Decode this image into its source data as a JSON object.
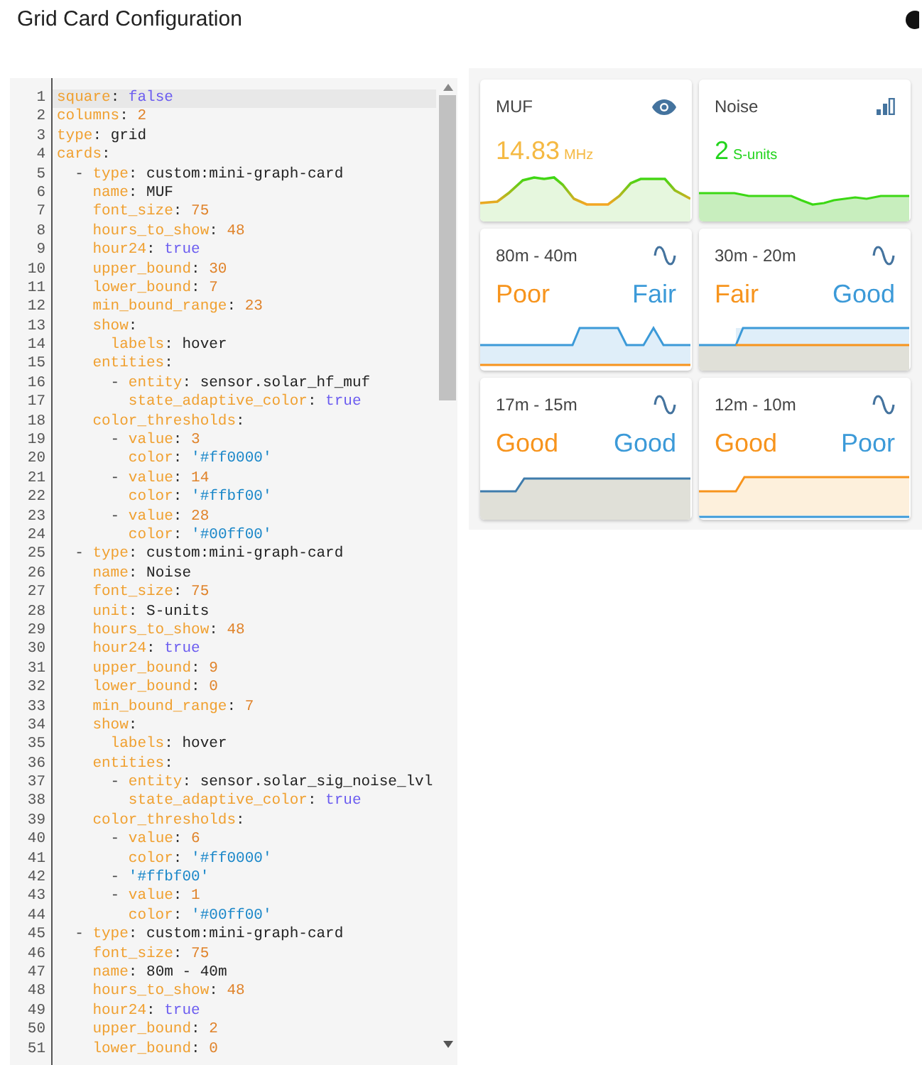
{
  "title": "Grid Card Configuration",
  "editor": {
    "lines": [
      {
        "n": "1",
        "active": true,
        "key": "square",
        "sep": ":",
        "value": " false",
        "kind": "bool"
      },
      {
        "n": "2",
        "active": false,
        "key": "columns",
        "sep": ":",
        "value": " 2",
        "kind": "num"
      },
      {
        "n": "3",
        "active": false,
        "key": "type",
        "sep": ":",
        "value": " grid",
        "kind": "plain"
      },
      {
        "n": "4",
        "active": false,
        "key": "cards",
        "sep": ":"
      },
      {
        "n": "5",
        "active": false,
        "lead": "  -",
        "key": " type",
        "sep": ":",
        "value": " custom:mini-graph-card",
        "kind": "plain"
      },
      {
        "n": "6",
        "active": false,
        "key": "    name",
        "sep": ":",
        "value": " MUF",
        "kind": "plain"
      },
      {
        "n": "7",
        "active": false,
        "key": "    font_size",
        "sep": ":",
        "value": " 75",
        "kind": "num"
      },
      {
        "n": "8",
        "active": false,
        "key": "    hours_to_show",
        "sep": ":",
        "value": " 48",
        "kind": "num"
      },
      {
        "n": "9",
        "active": false,
        "key": "    hour24",
        "sep": ":",
        "value": " true",
        "kind": "bool"
      },
      {
        "n": "10",
        "active": false,
        "key": "    upper_bound",
        "sep": ":",
        "value": " 30",
        "kind": "num"
      },
      {
        "n": "11",
        "active": false,
        "key": "    lower_bound",
        "sep": ":",
        "value": " 7",
        "kind": "num"
      },
      {
        "n": "12",
        "active": false,
        "key": "    min_bound_range",
        "sep": ":",
        "value": " 23",
        "kind": "num"
      },
      {
        "n": "13",
        "active": false,
        "key": "    show",
        "sep": ":"
      },
      {
        "n": "14",
        "active": false,
        "key": "      labels",
        "sep": ":",
        "value": " hover",
        "kind": "plain"
      },
      {
        "n": "15",
        "active": false,
        "key": "    entities",
        "sep": ":"
      },
      {
        "n": "16",
        "active": false,
        "lead": "      -",
        "key": " entity",
        "sep": ":",
        "value": " sensor.solar_hf_muf",
        "kind": "plain"
      },
      {
        "n": "17",
        "active": false,
        "key": "        state_adaptive_color",
        "sep": ":",
        "value": " true",
        "kind": "bool"
      },
      {
        "n": "18",
        "active": false,
        "key": "    color_thresholds",
        "sep": ":"
      },
      {
        "n": "19",
        "active": false,
        "lead": "      -",
        "key": " value",
        "sep": ":",
        "value": " 3",
        "kind": "num"
      },
      {
        "n": "20",
        "active": false,
        "key": "        color",
        "sep": ":",
        "value": " '#ff0000'",
        "kind": "str"
      },
      {
        "n": "21",
        "active": false,
        "lead": "      -",
        "key": " value",
        "sep": ":",
        "value": " 14",
        "kind": "num"
      },
      {
        "n": "22",
        "active": false,
        "key": "        color",
        "sep": ":",
        "value": " '#ffbf00'",
        "kind": "str"
      },
      {
        "n": "23",
        "active": false,
        "lead": "      -",
        "key": " value",
        "sep": ":",
        "value": " 28",
        "kind": "num"
      },
      {
        "n": "24",
        "active": false,
        "key": "        color",
        "sep": ":",
        "value": " '#00ff00'",
        "kind": "str"
      },
      {
        "n": "25",
        "active": false,
        "lead": "  -",
        "key": " type",
        "sep": ":",
        "value": " custom:mini-graph-card",
        "kind": "plain"
      },
      {
        "n": "26",
        "active": false,
        "key": "    name",
        "sep": ":",
        "value": " Noise",
        "kind": "plain"
      },
      {
        "n": "27",
        "active": false,
        "key": "    font_size",
        "sep": ":",
        "value": " 75",
        "kind": "num"
      },
      {
        "n": "28",
        "active": false,
        "key": "    unit",
        "sep": ":",
        "value": " S-units",
        "kind": "plain"
      },
      {
        "n": "29",
        "active": false,
        "key": "    hours_to_show",
        "sep": ":",
        "value": " 48",
        "kind": "num"
      },
      {
        "n": "30",
        "active": false,
        "key": "    hour24",
        "sep": ":",
        "value": " true",
        "kind": "bool"
      },
      {
        "n": "31",
        "active": false,
        "key": "    upper_bound",
        "sep": ":",
        "value": " 9",
        "kind": "num"
      },
      {
        "n": "32",
        "active": false,
        "key": "    lower_bound",
        "sep": ":",
        "value": " 0",
        "kind": "num"
      },
      {
        "n": "33",
        "active": false,
        "key": "    min_bound_range",
        "sep": ":",
        "value": " 7",
        "kind": "num"
      },
      {
        "n": "34",
        "active": false,
        "key": "    show",
        "sep": ":"
      },
      {
        "n": "35",
        "active": false,
        "key": "      labels",
        "sep": ":",
        "value": " hover",
        "kind": "plain"
      },
      {
        "n": "36",
        "active": false,
        "key": "    entities",
        "sep": ":"
      },
      {
        "n": "37",
        "active": false,
        "lead": "      -",
        "key": " entity",
        "sep": ":",
        "value": " sensor.solar_sig_noise_lvl",
        "kind": "plain"
      },
      {
        "n": "38",
        "active": false,
        "key": "        state_adaptive_color",
        "sep": ":",
        "value": " true",
        "kind": "bool"
      },
      {
        "n": "39",
        "active": false,
        "key": "    color_thresholds",
        "sep": ":"
      },
      {
        "n": "40",
        "active": false,
        "lead": "      -",
        "key": " value",
        "sep": ":",
        "value": " 6",
        "kind": "num"
      },
      {
        "n": "41",
        "active": false,
        "key": "        color",
        "sep": ":",
        "value": " '#ff0000'",
        "kind": "str"
      },
      {
        "n": "42",
        "active": false,
        "lead": "      -",
        "value": " '#ffbf00'",
        "kind": "str"
      },
      {
        "n": "43",
        "active": false,
        "lead": "      -",
        "key": " value",
        "sep": ":",
        "value": " 1",
        "kind": "num"
      },
      {
        "n": "44",
        "active": false,
        "key": "        color",
        "sep": ":",
        "value": " '#00ff00'",
        "kind": "str"
      },
      {
        "n": "45",
        "active": false,
        "lead": "  -",
        "key": " type",
        "sep": ":",
        "value": " custom:mini-graph-card",
        "kind": "plain"
      },
      {
        "n": "46",
        "active": false,
        "key": "    font_size",
        "sep": ":",
        "value": " 75",
        "kind": "num"
      },
      {
        "n": "47",
        "active": false,
        "key": "    name",
        "sep": ":",
        "value": " 80m - 40m",
        "kind": "plain"
      },
      {
        "n": "48",
        "active": false,
        "key": "    hours_to_show",
        "sep": ":",
        "value": " 48",
        "kind": "num"
      },
      {
        "n": "49",
        "active": false,
        "key": "    hour24",
        "sep": ":",
        "value": " true",
        "kind": "bool"
      },
      {
        "n": "50",
        "active": false,
        "key": "    upper_bound",
        "sep": ":",
        "value": " 2",
        "kind": "num"
      },
      {
        "n": "51",
        "active": false,
        "key": "    lower_bound",
        "sep": ":",
        "value": " 0",
        "kind": "num"
      }
    ]
  },
  "cards": [
    {
      "name": "MUF",
      "kind": "single",
      "state": "14.83",
      "unit": "MHz",
      "color": "#f5b942"
    },
    {
      "name": "Noise",
      "kind": "single",
      "state": "2",
      "unit": "S-units",
      "color": "#22d41c"
    },
    {
      "name": "80m - 40m",
      "kind": "dual",
      "values": [
        {
          "text": "Poor",
          "color": "#f7941d"
        },
        {
          "text": "Fair",
          "color": "#3c9ad8"
        }
      ]
    },
    {
      "name": "30m - 20m",
      "kind": "dual",
      "values": [
        {
          "text": "Fair",
          "color": "#f7941d"
        },
        {
          "text": "Good",
          "color": "#3c9ad8"
        }
      ]
    },
    {
      "name": "17m - 15m",
      "kind": "dual",
      "values": [
        {
          "text": "Good",
          "color": "#f7941d"
        },
        {
          "text": "Good",
          "color": "#3c9ad8"
        }
      ]
    },
    {
      "name": "12m - 10m",
      "kind": "dual",
      "values": [
        {
          "text": "Good",
          "color": "#f7941d"
        },
        {
          "text": "Poor",
          "color": "#3c9ad8"
        }
      ]
    }
  ]
}
